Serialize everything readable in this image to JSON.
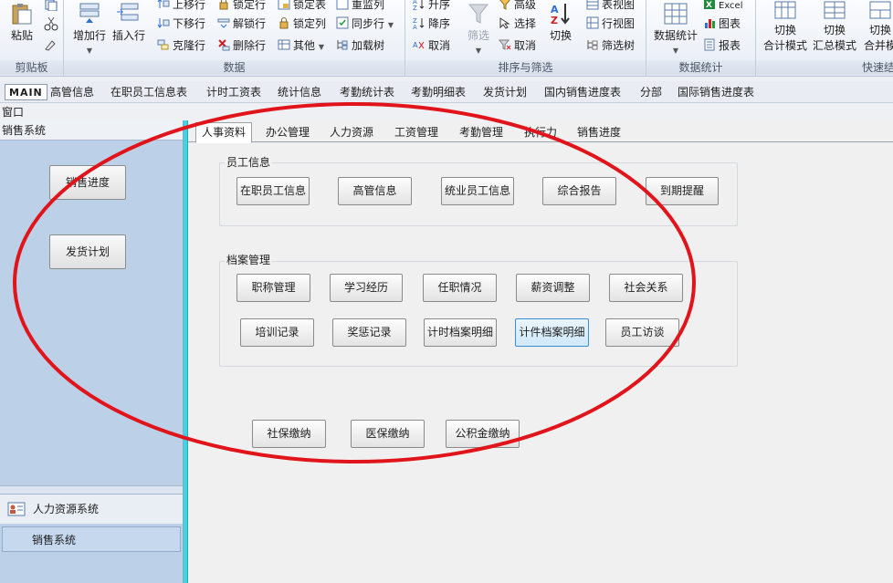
{
  "ribbon": {
    "clipboard": {
      "paste": "粘贴",
      "group": "剪贴板"
    },
    "data": {
      "add_row": "增加行",
      "insert_row": "插入行",
      "move_up": "上移行",
      "move_down": "下移行",
      "clone_row": "克隆行",
      "lock_row": "锁定行",
      "unlock_row": "解锁行",
      "delete_row": "删除行",
      "lock_table": "锁定表",
      "lock_col": "锁定列",
      "other": "其他",
      "overlay_col": "重监列",
      "sync_row": "同步行",
      "load_tree": "加载树",
      "group": "数据"
    },
    "sort": {
      "asc": "升序",
      "desc": "降序",
      "cancel": "取消",
      "filter": "筛选",
      "advanced": "高级",
      "select": "选择",
      "cancel2": "取消",
      "switch": "切换",
      "table_view": "表视图",
      "row_view": "行视图",
      "filter_tree": "筛选树",
      "group": "排序与筛选"
    },
    "stats": {
      "data_stats": "数据统计",
      "excel": "Excel",
      "chart": "图表",
      "report": "报表",
      "group": "数据统计"
    },
    "quick": {
      "switch1": "切换",
      "total_mode": "合计模式",
      "switch2": "切换",
      "summary_mode": "汇总模式",
      "switch3": "切换",
      "merge_mode": "合并模",
      "group": "快速结"
    }
  },
  "modules": {
    "items": [
      "MAIN",
      "高管信息",
      "在职员工信息表",
      "计时工资表",
      "统计信息",
      "考勤统计表",
      "考勤明细表",
      "发货计划",
      "国内销售进度表",
      "分部",
      "国际销售进度表"
    ]
  },
  "window_label": "窗口",
  "left_panel": {
    "header": "销售系统",
    "sales_progress": "销售进度",
    "shipping_plan": "发货计划",
    "hr_system": "人力资源系统",
    "sales_system": "销售系统"
  },
  "content": {
    "tabs": [
      "人事资料",
      "办公管理",
      "人力资源",
      "工资管理",
      "考勤管理",
      "执行力",
      "销售进度"
    ],
    "employee_info": {
      "legend": "员工信息",
      "buttons": [
        "在职员工信息",
        "高管信息",
        "统业员工信息",
        "综合报告",
        "到期提醒"
      ]
    },
    "archive": {
      "legend": "档案管理",
      "row1": [
        "职称管理",
        "学习经历",
        "任职情况",
        "薪资调整",
        "社会关系"
      ],
      "row2": [
        "培训记录",
        "奖惩记录",
        "计时档案明细",
        "计件档案明细",
        "员工访谈"
      ]
    },
    "social": [
      "社保缴纳",
      "医保缴纳",
      "公积金缴纳"
    ]
  }
}
